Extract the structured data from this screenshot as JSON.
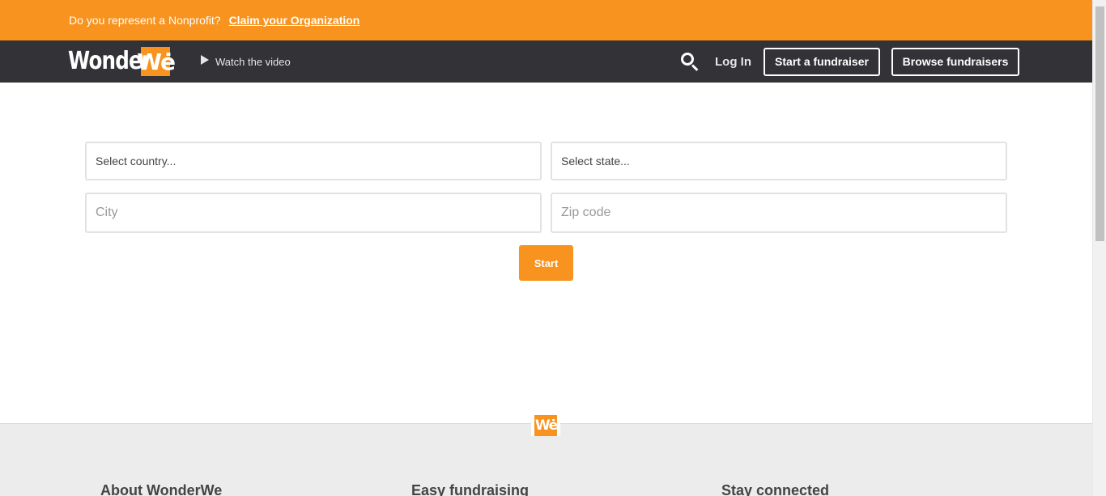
{
  "banner": {
    "question": "Do you represent a Nonprofit?",
    "claim_link": "Claim your Organization"
  },
  "nav": {
    "logo_word": "Wonder",
    "logo_mark": "Wė",
    "watch_video": "Watch the video",
    "login": "Log In",
    "start_fundraiser": "Start a fundraiser",
    "browse_fundraisers": "Browse fundraisers"
  },
  "form": {
    "country_placeholder": "Select country...",
    "state_placeholder": "Select state...",
    "city_placeholder": "City",
    "zip_placeholder": "Zip code",
    "start_label": "Start"
  },
  "footer": {
    "logo_mark": "Wė",
    "col1_title": "About WonderWe",
    "col2_title": "Easy fundraising",
    "col3_title": "Stay connected"
  },
  "colors": {
    "brand_orange": "#f7931e",
    "nav_dark": "#333236",
    "footer_bg": "#ececec"
  },
  "icons": [
    "play-icon",
    "search-icon"
  ]
}
